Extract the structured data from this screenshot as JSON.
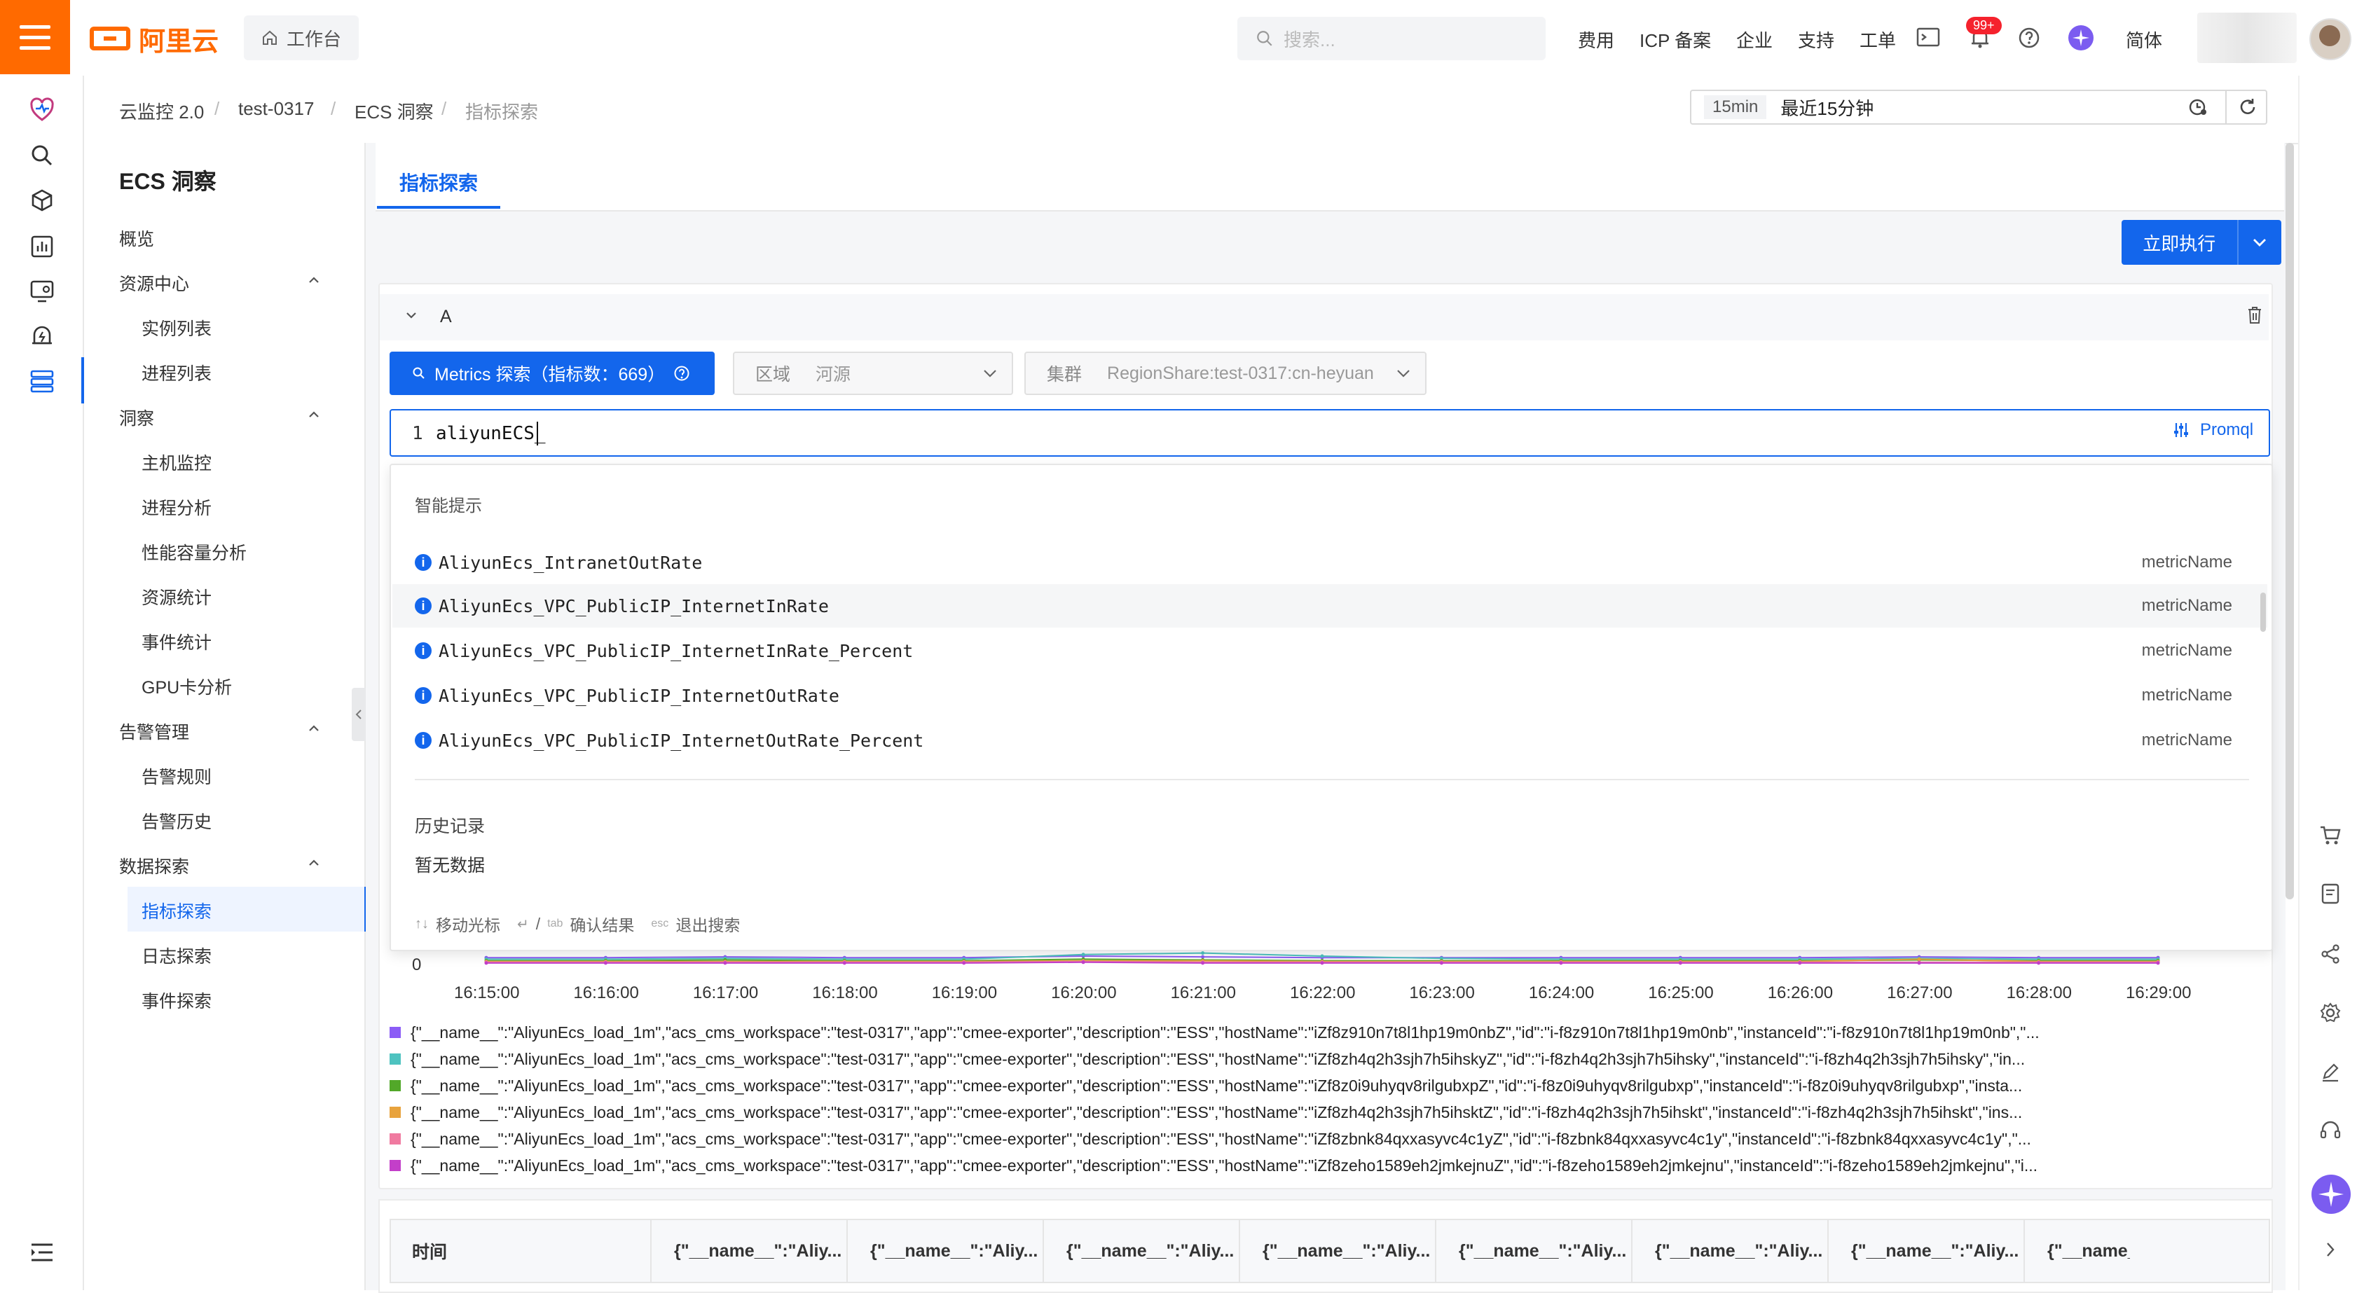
{
  "header": {
    "logo_text": "阿里云",
    "workbench_label": "工作台",
    "search_placeholder": "搜索...",
    "nav": [
      "费用",
      "ICP 备案",
      "企业",
      "支持",
      "工单"
    ],
    "notification_badge": "99+",
    "language_label": "简体",
    "brand_color": "#ff6a00",
    "accent_color": "#1366ec"
  },
  "breadcrumb": [
    "云监控 2.0",
    "test-0317",
    "ECS 洞察",
    "指标探索"
  ],
  "time_range": {
    "shortcut": "15min",
    "label": "最近15分钟"
  },
  "sidebar": {
    "title": "ECS 洞察",
    "overview": "概览",
    "groups": [
      {
        "label": "资源中心",
        "items": [
          "实例列表",
          "进程列表"
        ]
      },
      {
        "label": "洞察",
        "items": [
          "主机监控",
          "进程分析",
          "性能容量分析",
          "资源统计",
          "事件统计",
          "GPU卡分析"
        ]
      },
      {
        "label": "告警管理",
        "items": [
          "告警规则",
          "告警历史"
        ]
      },
      {
        "label": "数据探索",
        "items": [
          "指标探索",
          "日志探索",
          "事件探索"
        ]
      }
    ],
    "active_item": "指标探索"
  },
  "tabs": {
    "active": "指标探索"
  },
  "run_button": "立即执行",
  "query": {
    "name": "A",
    "metrics_button": "Metrics 探索（指标数：669）",
    "region_label": "区域",
    "region_value": "河源",
    "cluster_label": "集群",
    "cluster_value": "RegionShare:test-0317:cn-heyuan",
    "line_number": "1",
    "editor_value": "aliyunECS_",
    "promql_label": "Promql"
  },
  "suggestions": {
    "title": "智能提示",
    "items": [
      {
        "name": "AliyunEcs_IntranetOutRate",
        "kind": "metricName"
      },
      {
        "name": "AliyunEcs_VPC_PublicIP_InternetInRate",
        "kind": "metricName"
      },
      {
        "name": "AliyunEcs_VPC_PublicIP_InternetInRate_Percent",
        "kind": "metricName"
      },
      {
        "name": "AliyunEcs_VPC_PublicIP_InternetOutRate",
        "kind": "metricName"
      },
      {
        "name": "AliyunEcs_VPC_PublicIP_InternetOutRate_Percent",
        "kind": "metricName"
      }
    ],
    "history_title": "历史记录",
    "history_empty": "暂无数据",
    "hint_move": "移动光标",
    "hint_confirm": "确认结果",
    "hint_exit": "退出搜索",
    "hint_tab": "tab",
    "hint_esc": "esc"
  },
  "chart_data": {
    "type": "line",
    "y_tick": "0",
    "x": [
      "16:15:00",
      "16:16:00",
      "16:17:00",
      "16:18:00",
      "16:19:00",
      "16:20:00",
      "16:21:00",
      "16:22:00",
      "16:23:00",
      "16:24:00",
      "16:25:00",
      "16:26:00",
      "16:27:00",
      "16:28:00",
      "16:29:00"
    ],
    "series": [
      {
        "name": "{\"__name__\":\"AliyunEcs_load_1m\",\"acs_cms_workspace\":\"test-0317\",\"app\":\"cmee-exporter\",\"description\":\"ESS\",\"hostName\":\"iZf8z910n7t8l1hp19m0nbZ\",\"id\":\"i-f8z910n7t8l1hp19m0nb\",\"instanceId\":\"i-f8z910n7t8l1hp19m0nb\",\"...",
        "color": "#8b5cf6",
        "values": [
          0.08,
          0.08,
          0.09,
          0.08,
          0.08,
          0.1,
          0.09,
          0.08,
          0.08,
          0.08,
          0.08,
          0.08,
          0.09,
          0.08,
          0.08
        ]
      },
      {
        "name": "{\"__name__\":\"AliyunEcs_load_1m\",\"acs_cms_workspace\":\"test-0317\",\"app\":\"cmee-exporter\",\"description\":\"ESS\",\"hostName\":\"iZf8zh4q2h3sjh7h5ihskyZ\",\"id\":\"i-f8zh4q2h3sjh7h5ihsky\",\"instanceId\":\"i-f8zh4q2h3sjh7h5ihsky\",\"in...",
        "color": "#4ec3c0",
        "values": [
          0.06,
          0.06,
          0.07,
          0.06,
          0.06,
          0.12,
          0.14,
          0.1,
          0.07,
          0.06,
          0.06,
          0.06,
          0.07,
          0.06,
          0.06
        ]
      },
      {
        "name": "{\"__name__\":\"AliyunEcs_load_1m\",\"acs_cms_workspace\":\"test-0317\",\"app\":\"cmee-exporter\",\"description\":\"ESS\",\"hostName\":\"iZf8z0i9uhyqv8rilgubxpZ\",\"id\":\"i-f8z0i9uhyqv8rilgubxp\",\"instanceId\":\"i-f8z0i9uhyqv8rilgubxp\",\"insta...",
        "color": "#52a829",
        "values": [
          0.04,
          0.04,
          0.05,
          0.04,
          0.04,
          0.06,
          0.05,
          0.04,
          0.04,
          0.04,
          0.04,
          0.04,
          0.05,
          0.04,
          0.04
        ]
      },
      {
        "name": "{\"__name__\":\"AliyunEcs_load_1m\",\"acs_cms_workspace\":\"test-0317\",\"app\":\"cmee-exporter\",\"description\":\"ESS\",\"hostName\":\"iZf8zh4q2h3sjh7h5ihsktZ\",\"id\":\"i-f8zh4q2h3sjh7h5ihskt\",\"instanceId\":\"i-f8zh4q2h3sjh7h5ihskt\",\"ins...",
        "color": "#e8a33d",
        "values": [
          0.03,
          0.03,
          0.03,
          0.03,
          0.03,
          0.04,
          0.04,
          0.03,
          0.03,
          0.03,
          0.03,
          0.03,
          0.06,
          0.03,
          0.03
        ]
      },
      {
        "name": "{\"__name__\":\"AliyunEcs_load_1m\",\"acs_cms_workspace\":\"test-0317\",\"app\":\"cmee-exporter\",\"description\":\"ESS\",\"hostName\":\"iZf8zbnk84qxxasyvc4c1yZ\",\"id\":\"i-f8zbnk84qxxasyvc4c1y\",\"instanceId\":\"i-f8zbnk84qxxasyvc4c1y\",\"...",
        "color": "#f07aa0",
        "values": [
          0.02,
          0.02,
          0.02,
          0.02,
          0.02,
          0.03,
          0.02,
          0.02,
          0.02,
          0.02,
          0.02,
          0.02,
          0.02,
          0.02,
          0.02
        ]
      },
      {
        "name": "{\"__name__\":\"AliyunEcs_load_1m\",\"acs_cms_workspace\":\"test-0317\",\"app\":\"cmee-exporter\",\"description\":\"ESS\",\"hostName\":\"iZf8zeho1589eh2jmkejnuZ\",\"id\":\"i-f8zeho1589eh2jmkejnu\",\"instanceId\":\"i-f8zeho1589eh2jmkejnu\",\"i...",
        "color": "#c33fc9",
        "values": [
          0.01,
          0.01,
          0.01,
          0.01,
          0.01,
          0.02,
          0.01,
          0.01,
          0.01,
          0.01,
          0.01,
          0.01,
          0.01,
          0.01,
          0.01
        ]
      }
    ]
  },
  "table": {
    "headers": [
      "时间",
      "{\"__name__\":\"Aliy...",
      "{\"__name__\":\"Aliy...",
      "{\"__name__\":\"Aliy...",
      "{\"__name__\":\"Aliy...",
      "{\"__name__\":\"Aliy...",
      "{\"__name__\":\"Aliy...",
      "{\"__name__\":\"Aliy...",
      "{\"__name__\""
    ]
  }
}
